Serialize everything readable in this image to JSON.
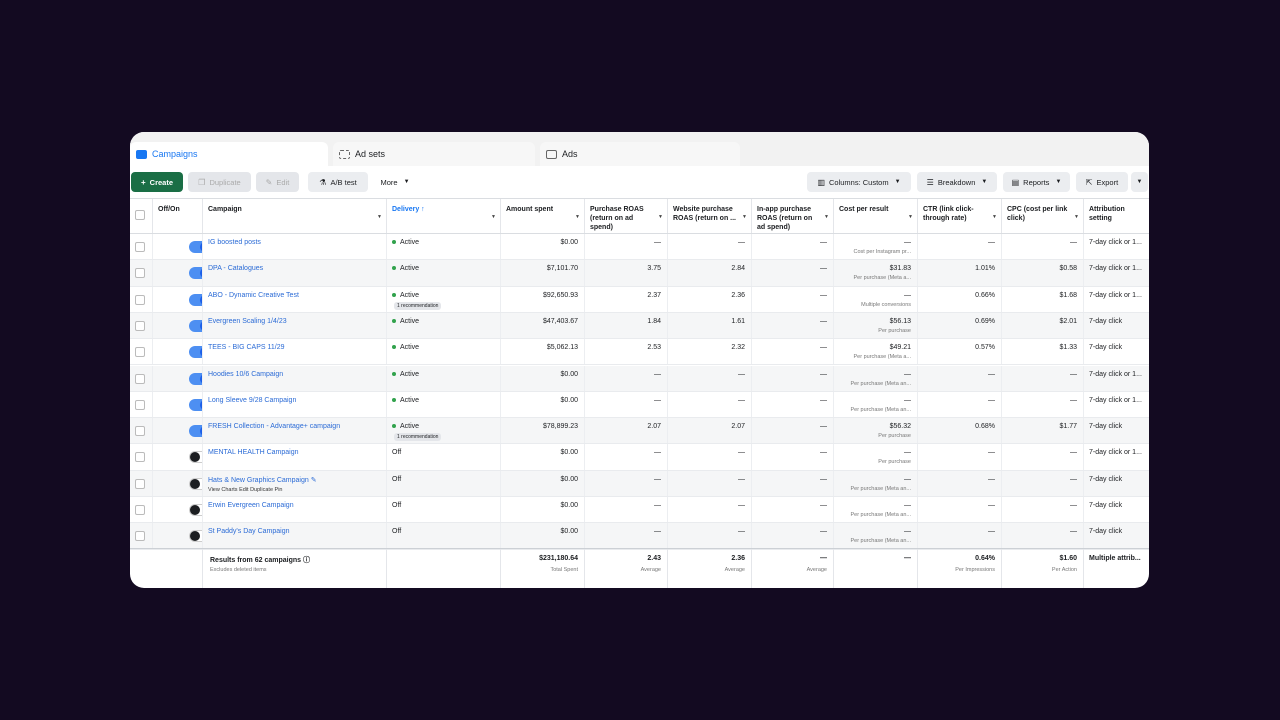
{
  "tabs": [
    {
      "label": "Campaigns",
      "icon": "folder-icon"
    },
    {
      "label": "Ad sets",
      "icon": "grid-icon"
    },
    {
      "label": "Ads",
      "icon": "square-icon"
    }
  ],
  "toolbar": {
    "create": "Create",
    "duplicate": "Duplicate",
    "edit": "Edit",
    "ab_test": "A/B test",
    "more": "More",
    "columns": "Columns: Custom",
    "breakdown": "Breakdown",
    "reports": "Reports",
    "export": "Export"
  },
  "headers": {
    "offon": "Off/On",
    "campaign": "Campaign",
    "delivery": "Delivery ↑",
    "amount": "Amount spent",
    "purchase_roas": "Purchase ROAS (return on ad spend)",
    "website_roas": "Website purchase ROAS (return on ...",
    "inapp_roas": "In-app purchase ROAS (return on ad spend)",
    "cost": "Cost per result",
    "ctr": "CTR (link click-through rate)",
    "cpc": "CPC (cost per link click)",
    "attr": "Attribution setting"
  },
  "rows": [
    {
      "on": true,
      "name": "IG boosted posts",
      "sub": "",
      "delivery": "Active",
      "badge": "",
      "amount": "$0.00",
      "proas": "—",
      "wroas": "—",
      "iroas": "—",
      "cost": "—",
      "cost_sub": "Cost per Instagram pr...",
      "ctr": "—",
      "cpc": "—",
      "attr": "7-day click or 1..."
    },
    {
      "on": true,
      "name": "DPA - Catalogues",
      "sub": "",
      "delivery": "Active",
      "badge": "",
      "amount": "$7,101.70",
      "proas": "3.75",
      "wroas": "2.84",
      "iroas": "—",
      "cost": "$31.83",
      "cost_sub": "Per purchase (Meta a...",
      "ctr": "1.01%",
      "cpc": "$0.58",
      "attr": "7-day click or 1..."
    },
    {
      "on": true,
      "name": "ABO - Dynamic Creative Test",
      "sub": "",
      "delivery": "Active",
      "badge": "1 recommendation",
      "amount": "$92,650.93",
      "proas": "2.37",
      "wroas": "2.36",
      "iroas": "—",
      "cost": "—",
      "cost_sub": "Multiple conversions",
      "ctr": "0.66%",
      "cpc": "$1.68",
      "attr": "7-day click or 1..."
    },
    {
      "on": true,
      "name": "Evergreen Scaling 1/4/23",
      "sub": "",
      "delivery": "Active",
      "badge": "",
      "amount": "$47,403.67",
      "proas": "1.84",
      "wroas": "1.61",
      "iroas": "—",
      "cost": "$56.13",
      "cost_sub": "Per purchase",
      "ctr": "0.69%",
      "cpc": "$2.01",
      "attr": "7-day click"
    },
    {
      "on": true,
      "name": "TEES - BIG CAPS 11/29",
      "sub": "",
      "delivery": "Active",
      "badge": "",
      "amount": "$5,062.13",
      "proas": "2.53",
      "wroas": "2.32",
      "iroas": "—",
      "cost": "$49.21",
      "cost_sub": "Per purchase (Meta a...",
      "ctr": "0.57%",
      "cpc": "$1.33",
      "attr": "7-day click"
    },
    {
      "on": true,
      "name": "Hoodies 10/6 Campaign",
      "sub": "",
      "delivery": "Active",
      "badge": "",
      "amount": "$0.00",
      "proas": "—",
      "wroas": "—",
      "iroas": "—",
      "cost": "—",
      "cost_sub": "Per purchase (Meta an...",
      "ctr": "—",
      "cpc": "—",
      "attr": "7-day click or 1..."
    },
    {
      "on": true,
      "name": "Long Sleeve 9/28 Campaign",
      "sub": "",
      "delivery": "Active",
      "badge": "",
      "amount": "$0.00",
      "proas": "—",
      "wroas": "—",
      "iroas": "—",
      "cost": "—",
      "cost_sub": "Per purchase (Meta an...",
      "ctr": "—",
      "cpc": "—",
      "attr": "7-day click or 1..."
    },
    {
      "on": true,
      "name": "FRESH Collection - Advantage+ campaign",
      "sub": "",
      "delivery": "Active",
      "badge": "1 recommendation",
      "amount": "$78,899.23",
      "proas": "2.07",
      "wroas": "2.07",
      "iroas": "—",
      "cost": "$56.32",
      "cost_sub": "Per purchase",
      "ctr": "0.68%",
      "cpc": "$1.77",
      "attr": "7-day click"
    },
    {
      "on": false,
      "name": "MENTAL HEALTH Campaign",
      "sub": "",
      "delivery": "Off",
      "badge": "",
      "amount": "$0.00",
      "proas": "—",
      "wroas": "—",
      "iroas": "—",
      "cost": "—",
      "cost_sub": "Per purchase",
      "ctr": "—",
      "cpc": "—",
      "attr": "7-day click or 1..."
    },
    {
      "on": false,
      "name": "Hats & New Graphics Campaign ✎",
      "sub": "View Charts   Edit   Duplicate   Pin",
      "delivery": "Off",
      "badge": "",
      "amount": "$0.00",
      "proas": "—",
      "wroas": "—",
      "iroas": "—",
      "cost": "—",
      "cost_sub": "Per purchase (Meta an...",
      "ctr": "—",
      "cpc": "—",
      "attr": "7-day click"
    },
    {
      "on": false,
      "name": "Erwin Evergreen Campaign",
      "sub": "",
      "delivery": "Off",
      "badge": "",
      "amount": "$0.00",
      "proas": "—",
      "wroas": "—",
      "iroas": "—",
      "cost": "—",
      "cost_sub": "Per purchase (Meta an...",
      "ctr": "—",
      "cpc": "—",
      "attr": "7-day click"
    },
    {
      "on": false,
      "name": "St Paddy's Day Campaign",
      "sub": "",
      "delivery": "Off",
      "badge": "",
      "amount": "$0.00",
      "proas": "—",
      "wroas": "—",
      "iroas": "—",
      "cost": "—",
      "cost_sub": "Per purchase (Meta an...",
      "ctr": "—",
      "cpc": "—",
      "attr": "7-day click"
    }
  ],
  "footer": {
    "title": "Results from 62 campaigns ⓘ",
    "title_sub": "Excludes deleted items",
    "amount": "$231,180.64",
    "amount_sub": "Total Spent",
    "proas": "2.43",
    "proas_sub": "Average",
    "wroas": "2.36",
    "wroas_sub": "Average",
    "iroas": "—",
    "iroas_sub": "Average",
    "cost": "—",
    "ctr": "0.64%",
    "ctr_sub": "Per Impressions",
    "cpc": "$1.60",
    "cpc_sub": "Per Action",
    "attr": "Multiple attrib..."
  }
}
